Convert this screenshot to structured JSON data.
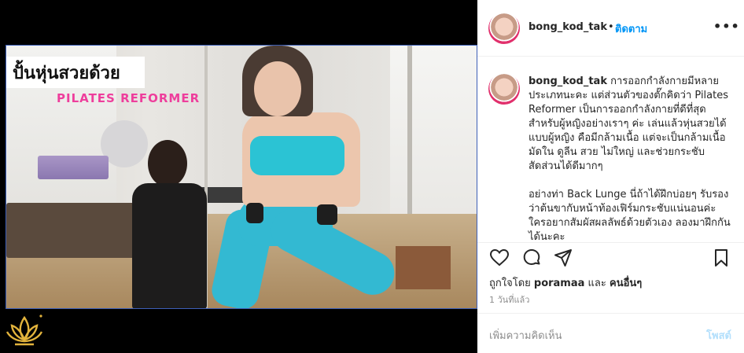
{
  "post": {
    "username": "bong_kod_tak",
    "follow_label": "ติดตาม",
    "separator": "•",
    "more_label": "•••"
  },
  "media": {
    "overlay_title": "ปั้นหุ่นสวยด้วย",
    "overlay_subtitle": "PILATES REFORMER"
  },
  "caption": {
    "username": "bong_kod_tak",
    "paragraph1": "การออกกำลังกายมีหลายประเภทนะคะ แต่ส่วนตัวของตั๊กคิดว่า Pilates Reformer เป็นการออกกำลังกายที่ดีที่สุดสำหรับผู้หญิงอย่างเราๆ ค่ะ เล่นแล้วหุ่นสวยได้แบบผู้หญิง คือมีกล้ามเนื้อ แต่จะเป็นกล้ามเนื้อมัดใน ดูลีน สวย ไม่ใหญ่ และช่วยกระชับสัดส่วนได้ดีมากๆ",
    "paragraph2": "อย่างท่า Back Lunge นี่ถ้าได้ฝึกบ่อยๆ รับรองว่าต้นขากับหน้าท้องเฟิร์มกระชับแน่นอนค่ะ ใครอยากสัมผัสผลลัพธ์ด้วยตัวเอง ลองมาฝึกกันได้นะคะ"
  },
  "actions": {
    "like_icon": "heart-icon",
    "comment_icon": "comment-icon",
    "share_icon": "paper-plane-icon",
    "save_icon": "bookmark-icon",
    "likes_prefix": "ถูกใจโดย",
    "likes_user": "poramaa",
    "likes_conj": "และ",
    "likes_others": "คนอื่นๆ",
    "timestamp": "1 วันที่แล้ว"
  },
  "comment": {
    "placeholder": "เพิ่มความคิดเห็น",
    "post_label": "โพสต์"
  },
  "colors": {
    "follow": "#0095f6",
    "post_disabled": "#b2dffc",
    "overlay_pink": "#ee3e9c",
    "outfit": "#33b9d2"
  }
}
